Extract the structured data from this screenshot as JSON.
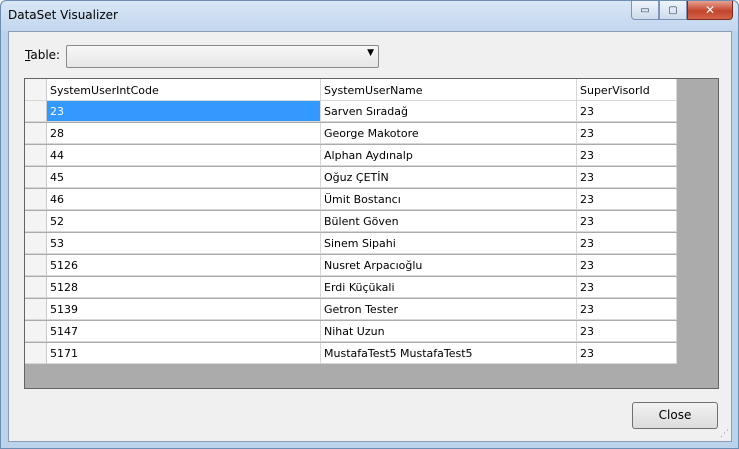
{
  "window": {
    "title": "DataSet Visualizer"
  },
  "caption": {
    "minimize": "▭",
    "maximize": "▢",
    "close": "✕"
  },
  "table_label": {
    "first": "T",
    "rest": "able:"
  },
  "combo": {
    "value": "",
    "arrow": "▼"
  },
  "grid": {
    "columns": [
      "SystemUserIntCode",
      "SystemUserName",
      "SuperVisorId"
    ],
    "rows": [
      [
        "23",
        "Sarven Sıradağ",
        "23"
      ],
      [
        "28",
        "George Makotore",
        "23"
      ],
      [
        "44",
        "Alphan Aydınalp",
        "23"
      ],
      [
        "45",
        "Oğuz ÇETİN",
        "23"
      ],
      [
        "46",
        "Ümit Bostancı",
        "23"
      ],
      [
        "52",
        "Bülent Göven",
        "23"
      ],
      [
        "53",
        "Sinem Sipahi",
        "23"
      ],
      [
        "5126",
        "Nusret Arpacıoğlu",
        "23"
      ],
      [
        "5128",
        "Erdi Küçükali",
        "23"
      ],
      [
        "5139",
        "Getron Tester",
        "23"
      ],
      [
        "5147",
        "Nihat Uzun",
        "23"
      ],
      [
        "5171",
        "MustafaTest5 MustafaTest5",
        "23"
      ]
    ]
  },
  "buttons": {
    "close": "Close"
  },
  "colors": {
    "selection": "#3399ff",
    "grid_background": "#ababab"
  }
}
